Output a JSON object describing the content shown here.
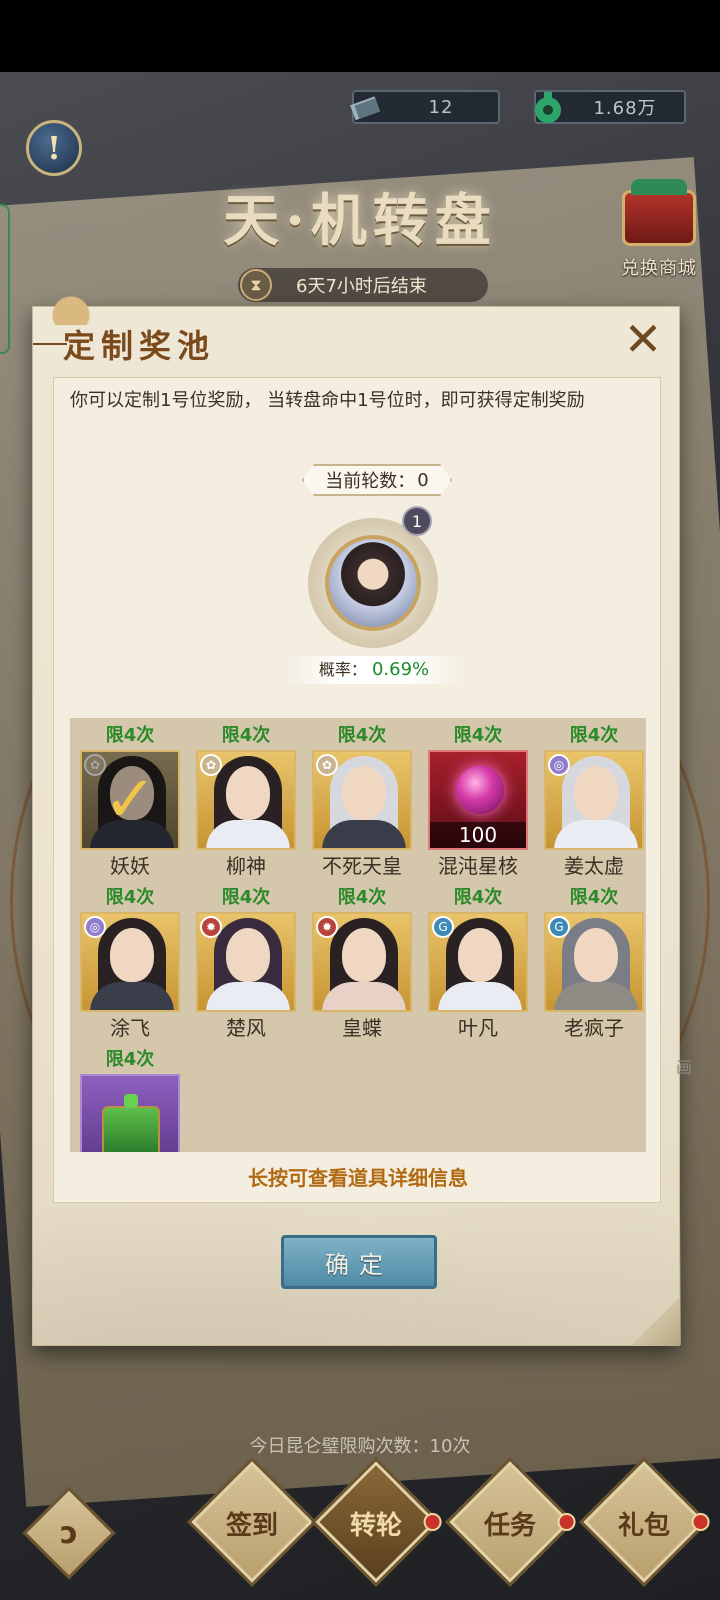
{
  "top_bar": {
    "jade_count": "12",
    "coin_count": "1.68万",
    "jade_icon": "jade-ticket-icon",
    "coin_icon": "jade-coin-icon"
  },
  "header": {
    "title": "天·机转盘",
    "shop_label": "兑换商城",
    "countdown": "6天7小时后结束"
  },
  "dialog": {
    "title": "定制奖池",
    "description": "你可以定制1号位奖励， 当转盘命中1号位时，即可获得定制奖励",
    "round_label": "当前轮数：",
    "round_value": "0",
    "featured_badge": "1",
    "prob_label": "概率：",
    "prob_value": "0.69%",
    "hint": "长按可查看道具详细信息",
    "confirm_label": "确定"
  },
  "items": [
    {
      "limit": "限4次",
      "name": "妖妖",
      "selected": true
    },
    {
      "limit": "限4次",
      "name": "柳神"
    },
    {
      "limit": "限4次",
      "name": "不死天皇"
    },
    {
      "limit": "限4次",
      "name": "混沌星核",
      "quantity": "100"
    },
    {
      "limit": "限4次",
      "name": "姜太虚"
    },
    {
      "limit": "限4次",
      "name": "涂飞"
    },
    {
      "limit": "限4次",
      "name": "楚风"
    },
    {
      "limit": "限4次",
      "name": "皇蝶"
    },
    {
      "limit": "限4次",
      "name": "叶凡"
    },
    {
      "limit": "限4次",
      "name": "老疯子"
    },
    {
      "limit": "限4次",
      "name": ""
    }
  ],
  "footer": {
    "purchase_info": "今日昆仑璧限购次数：10次",
    "buttons": [
      {
        "label": "签到"
      },
      {
        "label": "转轮"
      },
      {
        "label": "任务"
      },
      {
        "label": "礼包"
      }
    ]
  },
  "colors": {
    "limit_green": "#2d8a2b",
    "prob_green": "#1f8a2c",
    "hint_orange": "#b26a12",
    "confirm_blue": "#5f9ab4"
  }
}
